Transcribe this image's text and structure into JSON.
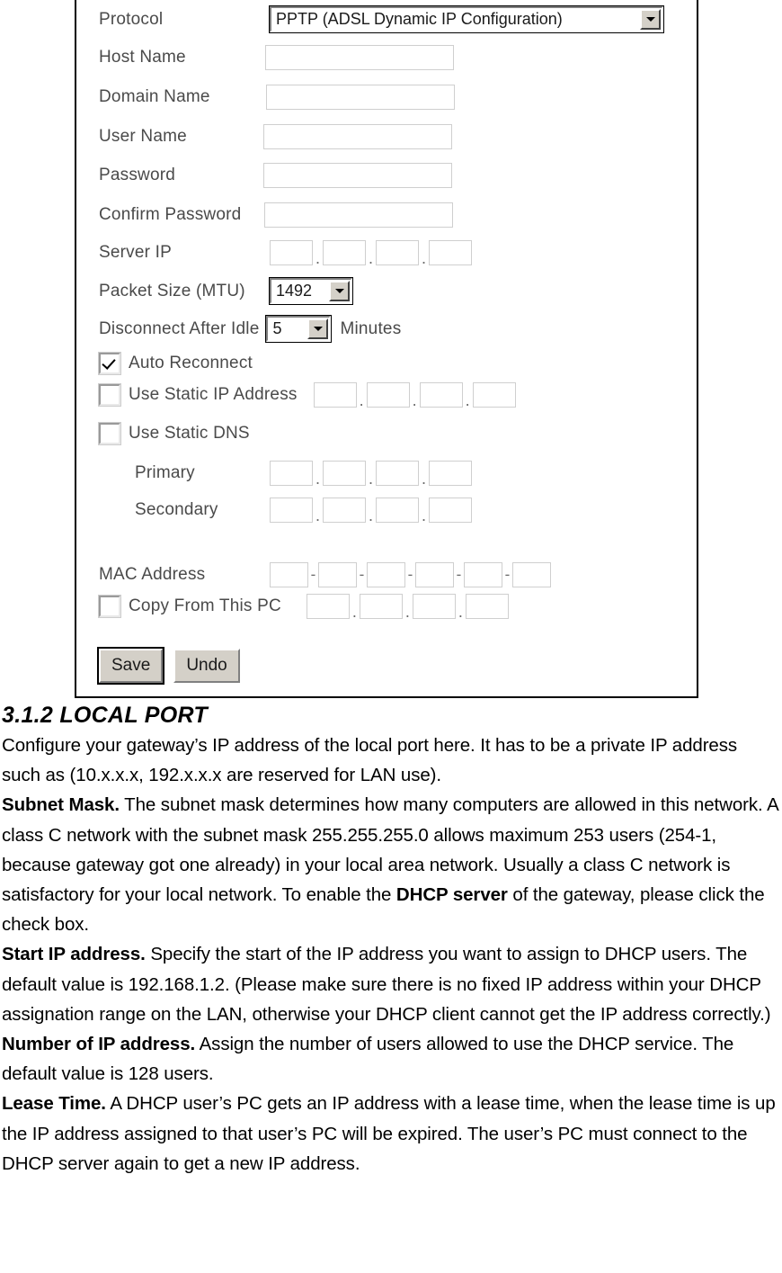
{
  "form": {
    "protocol": {
      "label": "Protocol",
      "value": "PPTP (ADSL Dynamic IP Configuration)"
    },
    "host_name": {
      "label": "Host Name",
      "value": ""
    },
    "domain_name": {
      "label": "Domain Name",
      "value": ""
    },
    "user_name": {
      "label": "User Name",
      "value": ""
    },
    "password": {
      "label": "Password",
      "value": ""
    },
    "confirm_password": {
      "label": "Confirm Password",
      "value": ""
    },
    "server_ip": {
      "label": "Server IP",
      "octets": [
        "",
        "",
        "",
        ""
      ],
      "separator": "."
    },
    "packet_size": {
      "label": "Packet Size (MTU)",
      "value": "1492"
    },
    "disconnect_idle": {
      "label": "Disconnect After Idle",
      "value": "5",
      "unit": "Minutes"
    },
    "auto_reconnect": {
      "label": "Auto Reconnect",
      "checked": true
    },
    "use_static_ip": {
      "label": "Use Static IP Address",
      "checked": false,
      "octets": [
        "",
        "",
        "",
        ""
      ],
      "separator": "."
    },
    "use_static_dns": {
      "label": "Use Static DNS",
      "checked": false
    },
    "dns_primary": {
      "label": "Primary",
      "octets": [
        "",
        "",
        "",
        ""
      ],
      "separator": "."
    },
    "dns_secondary": {
      "label": "Secondary",
      "octets": [
        "",
        "",
        "",
        ""
      ],
      "separator": "."
    },
    "mac_address": {
      "label": "MAC Address",
      "octets": [
        "",
        "",
        "",
        "",
        "",
        ""
      ],
      "separator": "-"
    },
    "copy_from_pc": {
      "label": "Copy From This PC",
      "checked": false,
      "octets": [
        "",
        "",
        "",
        ""
      ],
      "separator": "."
    },
    "buttons": {
      "save": "Save",
      "undo": "Undo"
    }
  },
  "document": {
    "heading": "3.1.2 LOCAL PORT",
    "paragraphs": [
      {
        "lead": "",
        "text": "Configure your gateway’s IP address of the local port here. It has to be a private IP address such as (10.x.x.x, 192.x.x.x are reserved for LAN use)."
      },
      {
        "lead": "Subnet Mask.",
        "text": " The subnet mask determines how many computers are allowed in this network. A class C network with the subnet mask 255.255.255.0 allows maximum 253 users (254-1, because gateway got one already) in your local area network. Usually a class C network is satisfactory for your local network. To enable the "
      },
      {
        "lead": "Start IP address.",
        "text": " Specify the start of the IP address you want to assign to DHCP users. The default value is 192.168.1.2. (Please make sure there is no fixed IP address within your DHCP assignation range on the LAN, otherwise your DHCP client cannot get the IP address correctly.)"
      },
      {
        "lead": "Number of IP address.",
        "text": " Assign the number of users allowed to use the DHCP service. The default value is 128 users."
      },
      {
        "lead": "Lease Time.",
        "text": " A DHCP user’s PC gets an IP address with a lease time, when the lease time is up the IP address assigned to that user’s PC will be expired. The user’s PC must connect to the DHCP server again to get a new IP address."
      }
    ],
    "inline": {
      "dhcp_server_bold": "DHCP server",
      "dhcp_server_tail": " of the gateway, please click the check box."
    }
  },
  "colors": {
    "panel_border": "#000000",
    "input_border": "#cfcfcf",
    "label_text": "#4a4a4a",
    "button_face": "#d4d0c8",
    "body_text": "#000000"
  }
}
